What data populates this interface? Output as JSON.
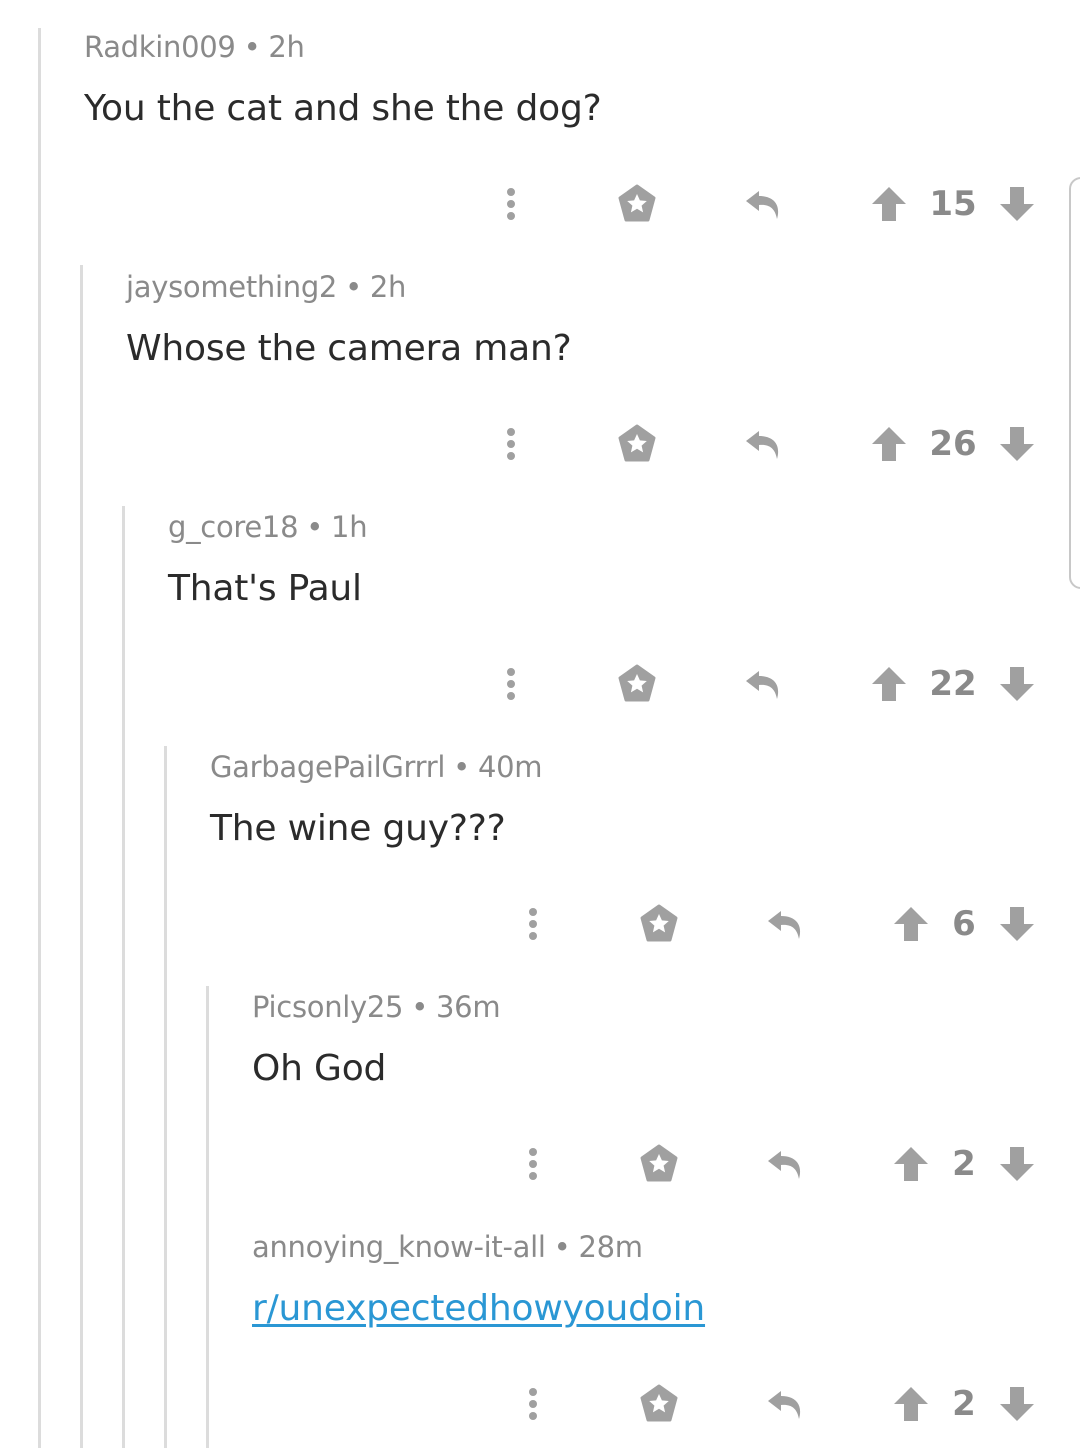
{
  "comments": [
    {
      "author": "Radkin009",
      "time": "2h",
      "text": "You the cat and she the dog?",
      "score": "15",
      "is_link": false
    },
    {
      "author": "jaysomething2",
      "time": "2h",
      "text": "Whose the camera man?",
      "score": "26",
      "is_link": false
    },
    {
      "author": "g_core18",
      "time": "1h",
      "text": "That's Paul",
      "score": "22",
      "is_link": false
    },
    {
      "author": "GarbagePailGrrrl",
      "time": "40m",
      "text": "The wine guy???",
      "score": "6",
      "is_link": false
    },
    {
      "author": "Picsonly25",
      "time": "36m",
      "text": "Oh God",
      "score": "2",
      "is_link": false
    },
    {
      "author": "annoying_know-it-all",
      "time": "28m",
      "text": "r/unexpectedhowyoudoin",
      "score": "2",
      "is_link": true
    }
  ],
  "separator": "•",
  "colors": {
    "icon": "#a0a0a0",
    "link": "#2a97d4",
    "thread_line": "#dcdcdc",
    "meta": "#8a8a8a",
    "body": "#2b2b2b"
  },
  "icons": [
    "more-options-icon",
    "award-icon",
    "reply-icon",
    "upvote-icon",
    "downvote-icon"
  ]
}
